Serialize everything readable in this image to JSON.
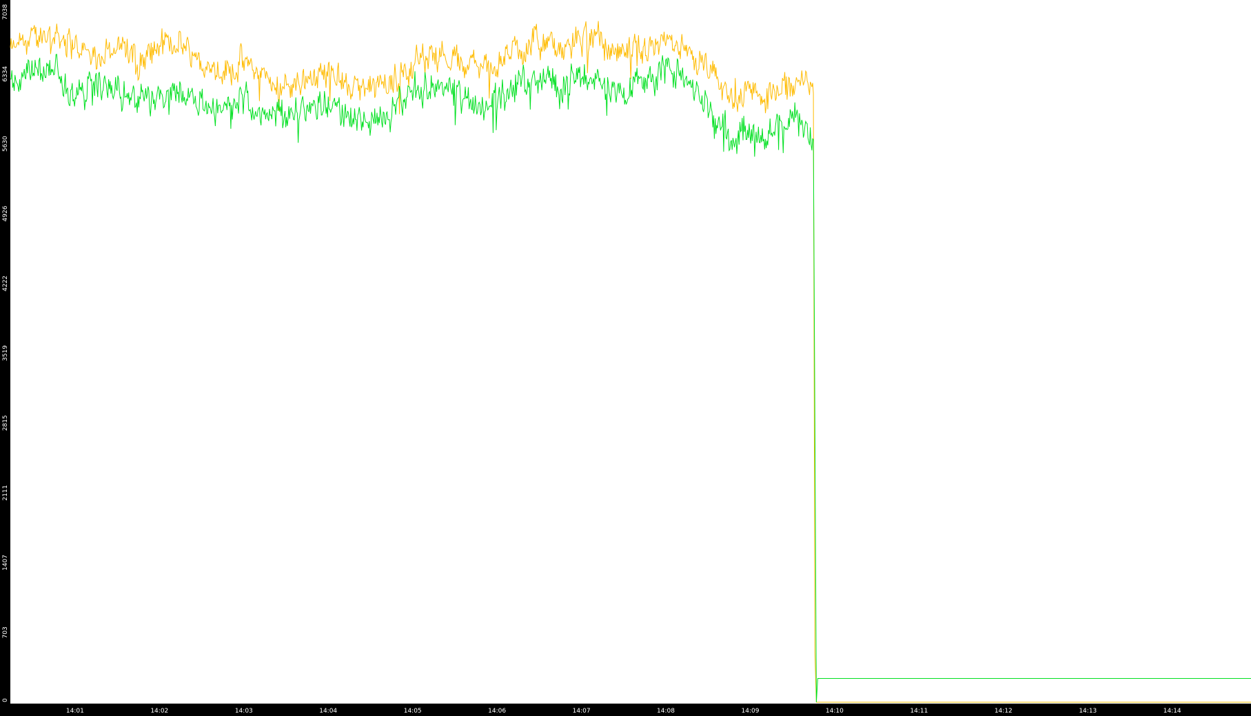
{
  "chart_data": {
    "type": "line",
    "title": "",
    "xlabel": "",
    "ylabel": "",
    "background": "#ffffff",
    "axis_color": "#000000",
    "tick_label_color": "#ffffff",
    "grid": false,
    "legend": "none",
    "xlim": [
      "14:00:14",
      "14:14:56"
    ],
    "ylim": [
      0,
      7038
    ],
    "yticks": [
      0,
      703,
      1407,
      2111,
      2815,
      3519,
      4222,
      4926,
      5630,
      6334,
      7038
    ],
    "xticks": [
      "14:01",
      "14:02",
      "14:03",
      "14:04",
      "14:05",
      "14:06",
      "14:07",
      "14:08",
      "14:09",
      "14:10",
      "14:11",
      "14:12",
      "14:13",
      "14:14"
    ],
    "noise": {
      "orange": 220,
      "green": 230
    },
    "series": [
      {
        "color": "#ffbb00",
        "x": [
          "14:00:14",
          "14:00:30",
          "14:00:45",
          "14:01:00",
          "14:01:15",
          "14:01:30",
          "14:01:45",
          "14:02:00",
          "14:02:15",
          "14:02:30",
          "14:02:45",
          "14:03:00",
          "14:03:15",
          "14:03:30",
          "14:03:45",
          "14:04:00",
          "14:04:15",
          "14:04:30",
          "14:04:45",
          "14:05:00",
          "14:05:15",
          "14:05:30",
          "14:05:45",
          "14:06:00",
          "14:06:15",
          "14:06:30",
          "14:06:45",
          "14:07:00",
          "14:07:15",
          "14:07:30",
          "14:07:45",
          "14:08:00",
          "14:08:15",
          "14:08:30",
          "14:08:45",
          "14:09:00",
          "14:09:15",
          "14:09:30",
          "14:09:45",
          "14:09:46",
          "14:09:47",
          "14:14:56"
        ],
        "values": [
          6550,
          6700,
          6750,
          6600,
          6500,
          6650,
          6450,
          6600,
          6650,
          6500,
          6350,
          6450,
          6300,
          6200,
          6300,
          6350,
          6200,
          6150,
          6250,
          6450,
          6550,
          6500,
          6400,
          6450,
          6600,
          6650,
          6550,
          6700,
          6650,
          6500,
          6600,
          6700,
          6550,
          6350,
          6100,
          6150,
          6100,
          6250,
          6250,
          500,
          0,
          0
        ]
      },
      {
        "color": "#00e020",
        "x": [
          "14:00:14",
          "14:00:30",
          "14:00:45",
          "14:01:00",
          "14:01:15",
          "14:01:30",
          "14:01:45",
          "14:02:00",
          "14:02:15",
          "14:02:30",
          "14:02:45",
          "14:03:00",
          "14:03:15",
          "14:03:30",
          "14:03:45",
          "14:04:00",
          "14:04:15",
          "14:04:30",
          "14:04:45",
          "14:05:00",
          "14:05:15",
          "14:05:30",
          "14:05:45",
          "14:06:00",
          "14:06:15",
          "14:06:30",
          "14:06:45",
          "14:07:00",
          "14:07:15",
          "14:07:30",
          "14:07:45",
          "14:08:00",
          "14:08:15",
          "14:08:30",
          "14:08:45",
          "14:09:00",
          "14:09:15",
          "14:09:30",
          "14:09:45",
          "14:09:46",
          "14:09:47",
          "14:09:48",
          "14:14:56"
        ],
        "values": [
          6250,
          6350,
          6400,
          6100,
          6250,
          6150,
          6050,
          6150,
          6200,
          6050,
          5950,
          6100,
          5950,
          5900,
          6000,
          6050,
          5900,
          5850,
          5950,
          6150,
          6250,
          6150,
          6000,
          6050,
          6250,
          6300,
          6200,
          6300,
          6250,
          6150,
          6300,
          6400,
          6250,
          6000,
          5750,
          5800,
          5750,
          5900,
          5700,
          2815,
          0,
          240,
          240
        ]
      }
    ]
  }
}
